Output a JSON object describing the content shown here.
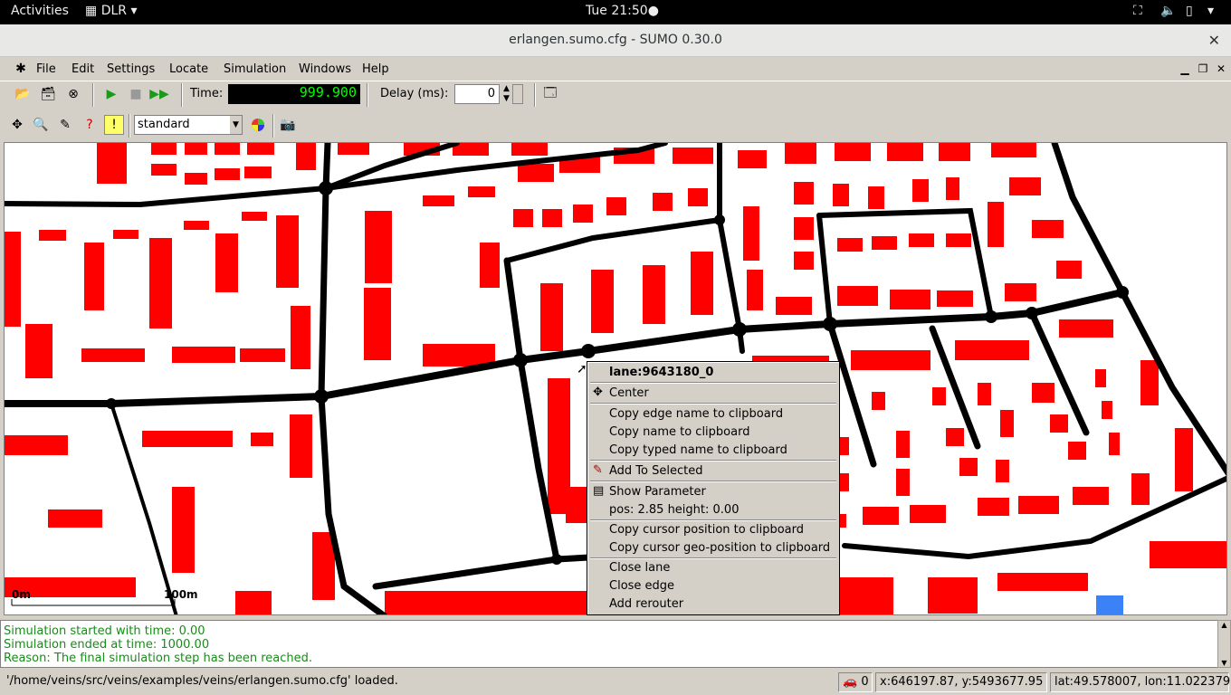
{
  "topbar": {
    "activities": "Activities",
    "app_menu": "DLR",
    "clock": "Tue 21:50●"
  },
  "window": {
    "title": "erlangen.sumo.cfg - SUMO 0.30.0"
  },
  "menu": {
    "file": "File",
    "edit": "Edit",
    "settings": "Settings",
    "locate": "Locate",
    "simulation": "Simulation",
    "windows": "Windows",
    "help": "Help"
  },
  "toolbar": {
    "time_label": "Time:",
    "time_value": "999.900",
    "delay_label": "Delay (ms):",
    "delay_value": "0"
  },
  "view_toolbar": {
    "scheme_selected": "standard"
  },
  "scale_bar": {
    "left_label": "0m",
    "right_label": "100m"
  },
  "context_menu": {
    "header": "lane:9643180_0",
    "center": "Center",
    "copy_edge": "Copy edge name to clipboard",
    "copy_name": "Copy name to clipboard",
    "copy_typed": "Copy typed name to clipboard",
    "add_selected": "Add To Selected",
    "show_param": "Show Parameter",
    "pos_info": "pos: 2.85 height: 0.00",
    "copy_cursor": "Copy cursor position to clipboard",
    "copy_geo": "Copy cursor geo-position to clipboard",
    "close_lane": "Close lane",
    "close_edge": "Close edge",
    "add_rerouter": "Add rerouter"
  },
  "messages": [
    "Simulation started with time: 0.00",
    "Simulation ended at time: 1000.00",
    "Reason: The final simulation step has been reached."
  ],
  "status": {
    "loaded": "'/home/veins/src/veins/examples/veins/erlangen.sumo.cfg' loaded.",
    "vehicles": "0",
    "xy": "x:646197.87, y:5493677.95",
    "latlon": "lat:49.578007, lon:11.022379"
  },
  "colors": {
    "building": "#ff0000",
    "road": "#000000",
    "time_display_bg": "#000000",
    "time_display_fg": "#00ff00",
    "message_text": "#1a8a1a"
  },
  "icons": [
    "sumo-logo-icon",
    "open-icon",
    "reload-icon",
    "close-sim-icon",
    "play-icon",
    "stop-icon",
    "step-icon",
    "new-view-icon",
    "recenter-icon",
    "locate-icon",
    "select-icon",
    "show-params-icon",
    "tooltip-icon",
    "color-scheme-icon",
    "screenshot-icon",
    "car-icon"
  ]
}
